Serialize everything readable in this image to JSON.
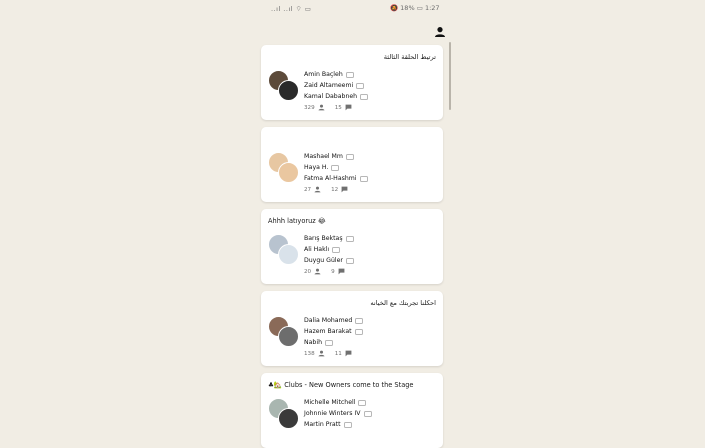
{
  "status_bar": {
    "left_icons": "..ıl ..ıl ⌔ ▭",
    "battery": "18%",
    "time": "1:27"
  },
  "rooms": [
    {
      "title": "ترتيط الحلقة الثالثة",
      "title_rtl": true,
      "speakers": [
        "Amin Baçleh",
        "Zaid Altameemi",
        "Kamal Dababneh"
      ],
      "listeners": "329",
      "speaker_count": "15",
      "avatar_colors": [
        "#5c4a3a",
        "#2a2a2a"
      ]
    },
    {
      "title": "",
      "title_rtl": false,
      "speakers": [
        "Mashael Mm",
        "Haya H.",
        "Fatma Al-Hashmi"
      ],
      "listeners": "27",
      "speaker_count": "12",
      "avatar_colors": [
        "#e7c7a2",
        "#eac7a0"
      ]
    },
    {
      "title": "Ahhh latıyoruz 😂",
      "title_rtl": false,
      "speakers": [
        "Barış Bektaş",
        "Ali Haklı",
        "Duygu Güler"
      ],
      "listeners": "20",
      "speaker_count": "9",
      "avatar_colors": [
        "#b8c3cf",
        "#d9e2ea"
      ]
    },
    {
      "title": "احكلنا تجربتك مع الخيانه",
      "title_rtl": true,
      "speakers": [
        "Dalia Mohamed",
        "Hazem Barakat",
        "Nabih"
      ],
      "listeners": "138",
      "speaker_count": "11",
      "avatar_colors": [
        "#8a6a58",
        "#6d6d6d"
      ]
    },
    {
      "title": "♣🏡 Clubs - New Owners come to the Stage",
      "title_rtl": false,
      "speakers": [
        "Michelle Mitchell",
        "Johnnie Winters IV",
        "Martin Pratt"
      ],
      "listeners": "",
      "speaker_count": "",
      "avatar_colors": [
        "#a9b6b0",
        "#3a3a3a"
      ]
    }
  ],
  "icons": {
    "profile": "profile-icon",
    "listeners": "person-icon",
    "speakers": "chat-icon",
    "speaker_badge": "speech-bubble-icon"
  },
  "colors": {
    "background": "#f1ede4",
    "card": "#ffffff",
    "muted_text": "#707070"
  }
}
